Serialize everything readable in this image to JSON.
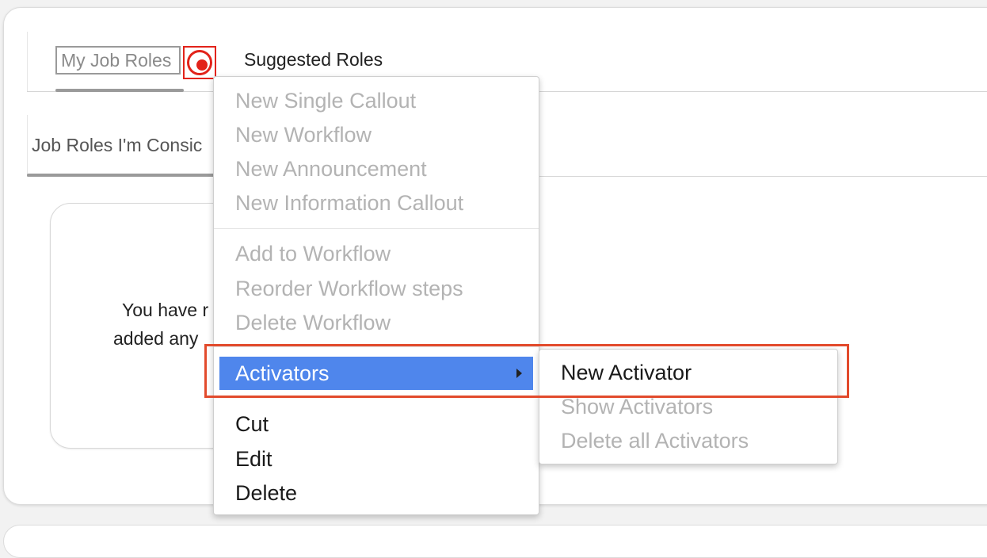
{
  "tabs": {
    "my_job_roles": "My Job Roles",
    "suggested_roles": "Suggested Roles"
  },
  "subtab": {
    "label": "Job Roles I'm Consic"
  },
  "empty_state": {
    "line1": "You have r",
    "line2": "added any"
  },
  "context_menu": {
    "group1": [
      "New Single Callout",
      "New Workflow",
      "New Announcement",
      "New Information Callout"
    ],
    "group2": [
      "Add to Workflow",
      "Reorder Workflow steps",
      "Delete Workflow"
    ],
    "activators": "Activators",
    "group3": [
      "Cut",
      "Edit",
      "Delete"
    ]
  },
  "submenu": {
    "new_activator": "New Activator",
    "show_activators": "Show Activators",
    "delete_all_activators": "Delete all Activators"
  },
  "colors": {
    "accent": "#4f86ec",
    "hotspot": "#e2231a",
    "highlight": "#e24a2c",
    "disabled_text": "#b3b3b3"
  },
  "icons": {
    "hotspot": "record-dot-icon",
    "submenu_arrow": "caret-right-icon"
  }
}
